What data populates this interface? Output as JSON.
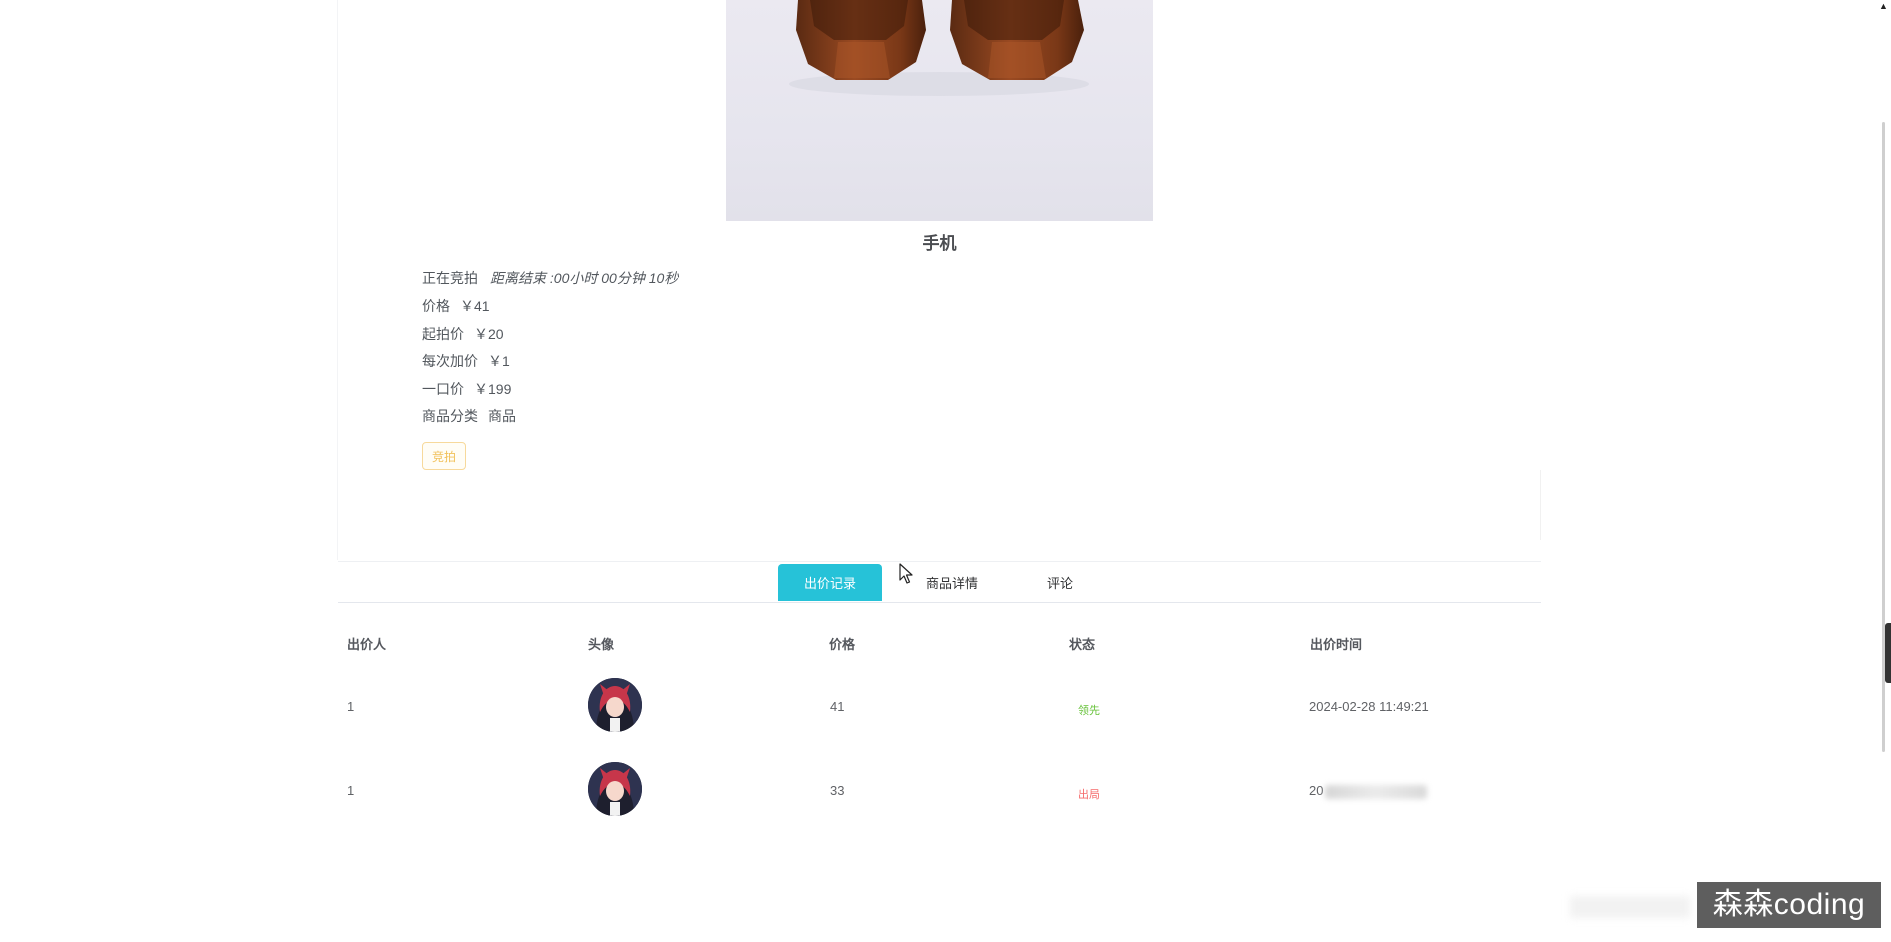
{
  "product": {
    "title": "手机",
    "status": "正在竞拍",
    "countdown": "距离结束 :00小时 00分钟 10秒",
    "price_label": "价格",
    "price": "￥41",
    "start_price_label": "起拍价",
    "start_price": "￥20",
    "increment_label": "每次加价",
    "increment": "￥1",
    "buyout_label": "一口价",
    "buyout": "￥199",
    "category_label": "商品分类",
    "category": "商品",
    "bid_button": "竞拍"
  },
  "tabs": [
    {
      "label": "出价记录",
      "active": true
    },
    {
      "label": "商品详情",
      "active": false
    },
    {
      "label": "评论",
      "active": false
    }
  ],
  "table": {
    "headers": [
      "出价人",
      "头像",
      "价格",
      "状态",
      "出价时间"
    ],
    "rows": [
      {
        "bidder": "1",
        "price": "41",
        "status": "领先",
        "time": "2024-02-28 11:49:21"
      },
      {
        "bidder": "1",
        "price": "33",
        "status": "出局",
        "time": "20"
      }
    ]
  },
  "watermark": "森森coding",
  "colors": {
    "accent": "#26c2d8",
    "lead": "#67c23a",
    "out": "#f56c6c",
    "bid_border": "#f7d99b"
  },
  "icons": [
    "cursor-arrow-icon",
    "scroll-up-arrow-icon",
    "avatar-image"
  ]
}
